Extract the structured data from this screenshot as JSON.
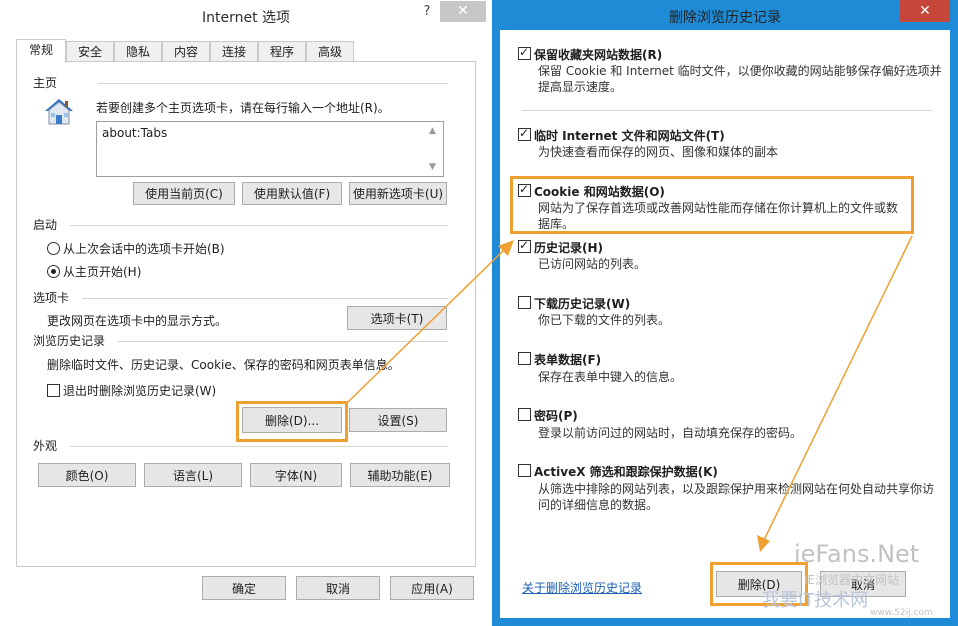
{
  "left_dialog": {
    "title": "Internet 选项",
    "help_label": "?",
    "close_label": "✕",
    "tabs": [
      "常规",
      "安全",
      "隐私",
      "内容",
      "连接",
      "程序",
      "高级"
    ],
    "home": {
      "section_label": "主页",
      "description": "若要创建多个主页选项卡，请在每行输入一个地址(R)。",
      "address_value": "about:Tabs",
      "buttons": [
        "使用当前页(C)",
        "使用默认值(F)",
        "使用新选项卡(U)"
      ]
    },
    "startup": {
      "section_label": "启动",
      "options": [
        "从上次会话中的选项卡开始(B)",
        "从主页开始(H)"
      ],
      "selected": "从主页开始(H)"
    },
    "tabs_section": {
      "section_label": "选项卡",
      "description": "更改网页在选项卡中的显示方式。",
      "button": "选项卡(T)"
    },
    "history": {
      "section_label": "浏览历史记录",
      "description": "删除临时文件、历史记录、Cookie、保存的密码和网页表单信息。",
      "checkbox_label": "退出时删除浏览历史记录(W)",
      "checkbox_checked": false,
      "delete_button": "删除(D)...",
      "settings_button": "设置(S)"
    },
    "appearance": {
      "section_label": "外观",
      "buttons": [
        "颜色(O)",
        "语言(L)",
        "字体(N)",
        "辅助功能(E)"
      ]
    },
    "footer_buttons": [
      "确定",
      "取消",
      "应用(A)"
    ]
  },
  "right_dialog": {
    "title": "删除浏览历史记录",
    "close_label": "✕",
    "options": [
      {
        "title": "保留收藏夹网站数据(R)",
        "desc": [
          "保留 Cookie 和 Internet 临时文件，以便你收藏的网站能够保存偏好选项并",
          "提高显示速度。"
        ],
        "checked": true
      },
      {
        "title": "临时 Internet 文件和网站文件(T)",
        "desc": [
          "为快速查看而保存的网页、图像和媒体的副本"
        ],
        "checked": true
      },
      {
        "title": "Cookie 和网站数据(O)",
        "desc": [
          "网站为了保存首选项或改善网站性能而存储在你计算机上的文件或数",
          "据库。"
        ],
        "checked": true
      },
      {
        "title": "历史记录(H)",
        "desc": [
          "已访问网站的列表。"
        ],
        "checked": true
      },
      {
        "title": "下载历史记录(W)",
        "desc": [
          "你已下载的文件的列表。"
        ],
        "checked": false
      },
      {
        "title": "表单数据(F)",
        "desc": [
          "保存在表单中键入的信息。"
        ],
        "checked": false
      },
      {
        "title": "密码(P)",
        "desc": [
          "登录以前访问过的网站时，自动填充保存的密码。"
        ],
        "checked": false
      },
      {
        "title": "ActiveX 筛选和跟踪保护数据(K)",
        "desc": [
          "从筛选中排除的网站列表，以及跟踪保护用来检测网站在何处自动共享你访",
          "问的详细信息的数据。"
        ],
        "checked": false
      }
    ],
    "about_link": "关于删除浏览历史记录",
    "delete_button": "删除(D)",
    "cancel_button": "取消"
  },
  "watermark": {
    "brand": "ieFans.Net",
    "subtitle": "IE浏览器中文网站",
    "bottom": "我要IT技术网",
    "url": "www.52ij.com"
  },
  "colors": {
    "highlight": "#f0a030",
    "right_frame": "#1d8bd6",
    "close_red": "#c7463a",
    "link": "#1c5fb3"
  }
}
